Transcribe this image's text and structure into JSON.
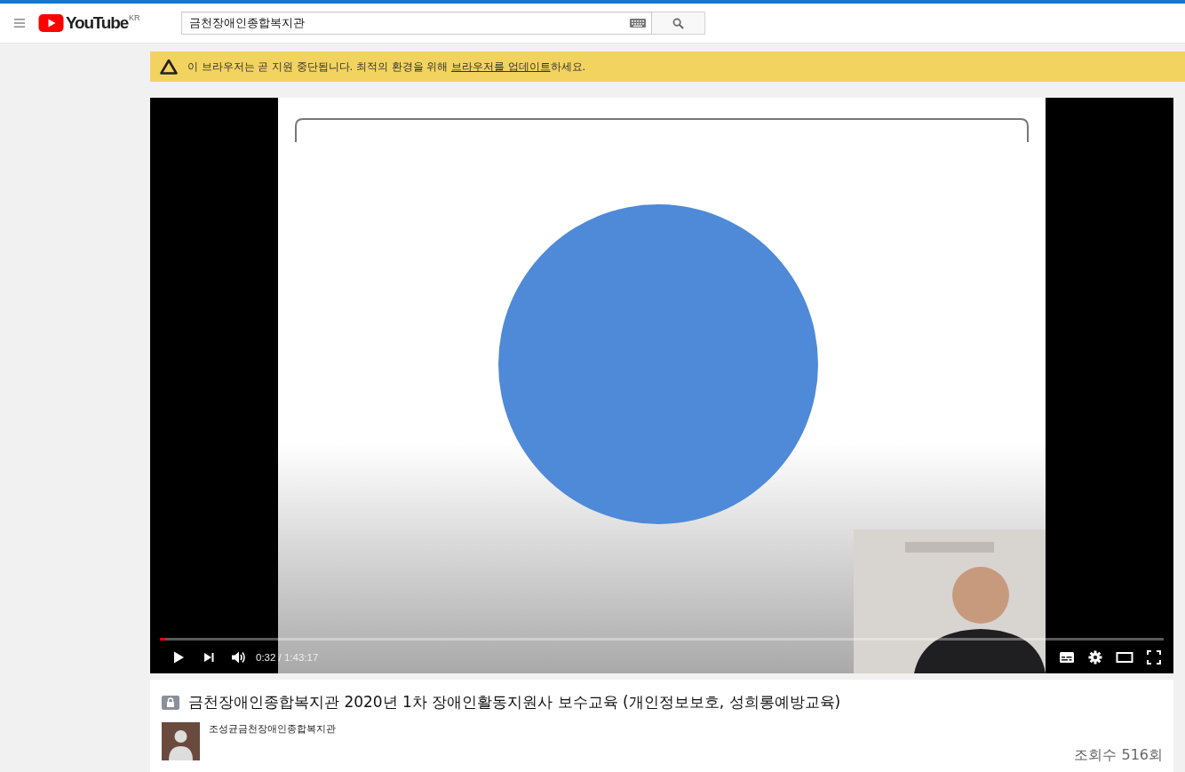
{
  "header": {
    "logo": "YouTube",
    "region": "KR",
    "search": {
      "value": "금천장애인종합복지관"
    }
  },
  "banner": {
    "message_start": "이 브라우저는 곧 지원 중단됩니다. 최적의 환경을 위해 ",
    "link": "브라우저를 업데이트",
    "message_end": "하세요."
  },
  "player": {
    "playing": false,
    "progress": {
      "level": 0.005
    },
    "time": "0:32 / 1:43:17"
  },
  "video": {
    "title": "금천장애인종합복지관 2020년 1차 장애인활동지원사 보수교육 (개인정보보호, 성희롱예방교육)",
    "channel": "조성균금천장애인종합복지관",
    "views": "조회수 516회"
  }
}
